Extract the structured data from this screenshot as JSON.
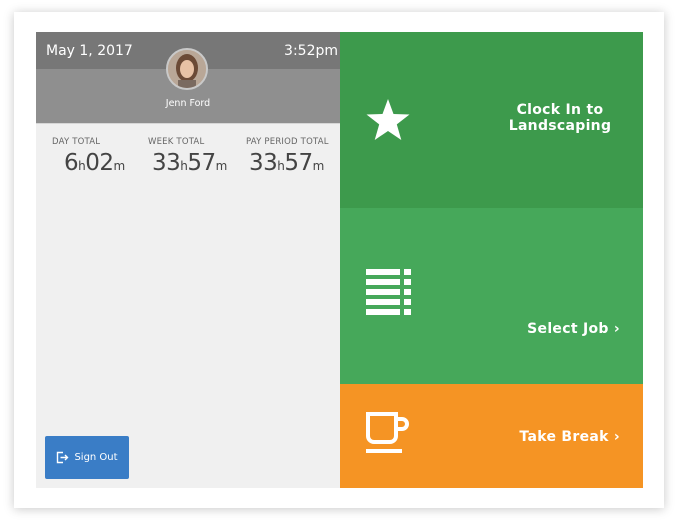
{
  "header": {
    "date": "May 1, 2017",
    "time": "3:52pm",
    "user_name": "Jenn Ford"
  },
  "totals": [
    {
      "label": "DAY TOTAL",
      "hours": "6",
      "minutes": "02"
    },
    {
      "label": "WEEK TOTAL",
      "hours": "33",
      "minutes": "57"
    },
    {
      "label": "PAY PERIOD TOTAL",
      "hours": "33",
      "minutes": "57"
    }
  ],
  "units": {
    "h": "h",
    "m": "m"
  },
  "sign_out": {
    "label": "Sign Out",
    "icon": "sign-out-icon"
  },
  "actions": {
    "clock_in": {
      "line1": "Clock In to",
      "line2": "Landscaping",
      "icon": "star-icon",
      "color": "#3d9a4c"
    },
    "select_job": {
      "label": "Select Job ›",
      "icon": "list-icon",
      "color": "#46a85a"
    },
    "take_break": {
      "label": "Take Break ›",
      "icon": "coffee-cup-icon",
      "color": "#f59424"
    }
  }
}
